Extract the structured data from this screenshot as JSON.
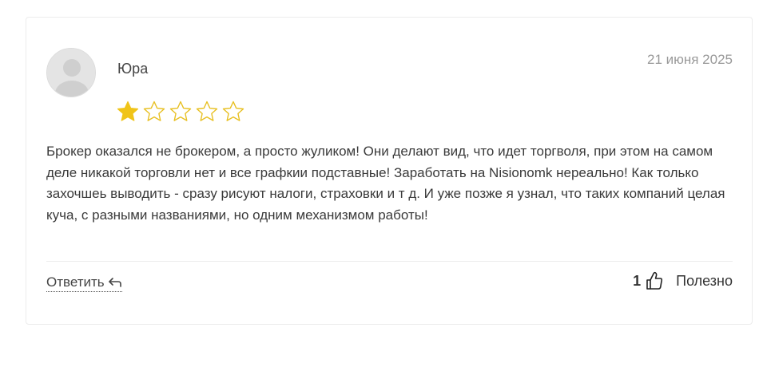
{
  "review": {
    "author": "Юра",
    "date": "21 июня 2025",
    "rating": 1,
    "rating_max": 5,
    "text": "Брокер оказался не брокером, а просто жуликом! Они делают вид, что идет торгволя, при этом на самом деле никакой торговли нет и все графкии подставные! Заработать на Nisionomk нереально! Как только захочшеь выводить - сразу рисуют налоги, страховки и т д. И уже позже я узнал, что таких компаний целая куча, с разными названиями, но одним механизмом работы!"
  },
  "actions": {
    "reply_label": "Ответить",
    "reply_icon": "reply-arrow-icon",
    "helpful_count": "1",
    "helpful_icon": "thumbs-up-icon",
    "helpful_label": "Полезно"
  },
  "colors": {
    "star_filled": "#f0c419",
    "star_outline": "#e8c022",
    "date": "#999999"
  }
}
